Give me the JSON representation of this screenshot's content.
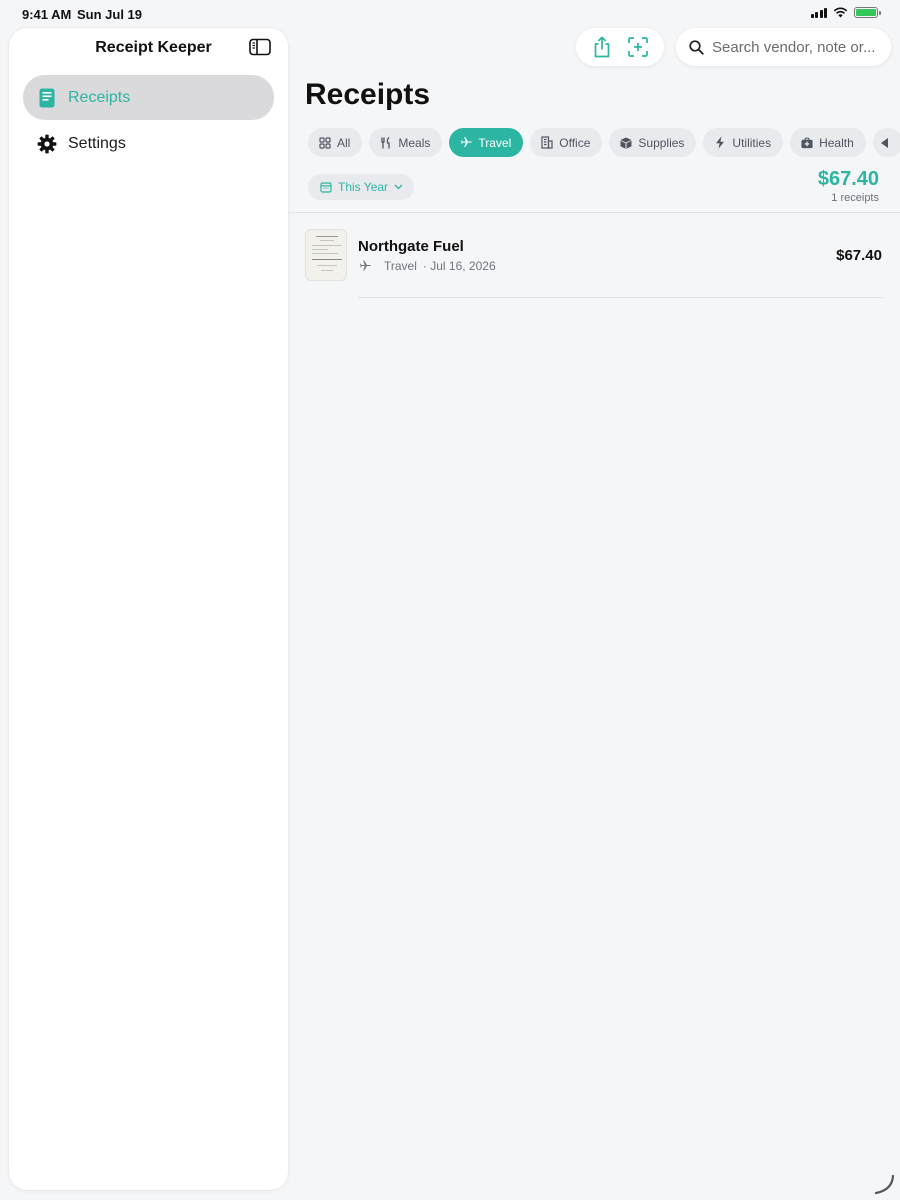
{
  "status_bar": {
    "time": "9:41 AM",
    "date": "Sun Jul 19"
  },
  "sidebar": {
    "title": "Receipt Keeper",
    "items": [
      {
        "label": "Receipts",
        "icon": "receipt-icon",
        "active": true
      },
      {
        "label": "Settings",
        "icon": "gear-icon",
        "active": false
      }
    ]
  },
  "toolbar": {
    "share_icon": "share-icon",
    "scan_icon": "scan-add-icon"
  },
  "search": {
    "placeholder": "Search vendor, note or..."
  },
  "main": {
    "title": "Receipts",
    "chips": [
      {
        "label": "All",
        "icon": "grid-icon",
        "active": false
      },
      {
        "label": "Meals",
        "icon": "fork-knife-icon",
        "active": false
      },
      {
        "label": "Travel",
        "icon": "airplane-icon",
        "active": true
      },
      {
        "label": "Office",
        "icon": "building-icon",
        "active": false
      },
      {
        "label": "Supplies",
        "icon": "box-icon",
        "active": false
      },
      {
        "label": "Utilities",
        "icon": "bolt-icon",
        "active": false
      },
      {
        "label": "Health",
        "icon": "medical-bag-icon",
        "active": false
      }
    ],
    "date_filter": "This Year",
    "total_amount": "$67.40",
    "total_count": "1 receipts",
    "receipts": [
      {
        "vendor": "Northgate Fuel",
        "category": "Travel",
        "date": "· Jul 16, 2026",
        "amount": "$67.40"
      }
    ]
  },
  "colors": {
    "accent": "#2cb5a3",
    "background": "#f5f6f8",
    "chip_bg": "#e9eaee"
  }
}
